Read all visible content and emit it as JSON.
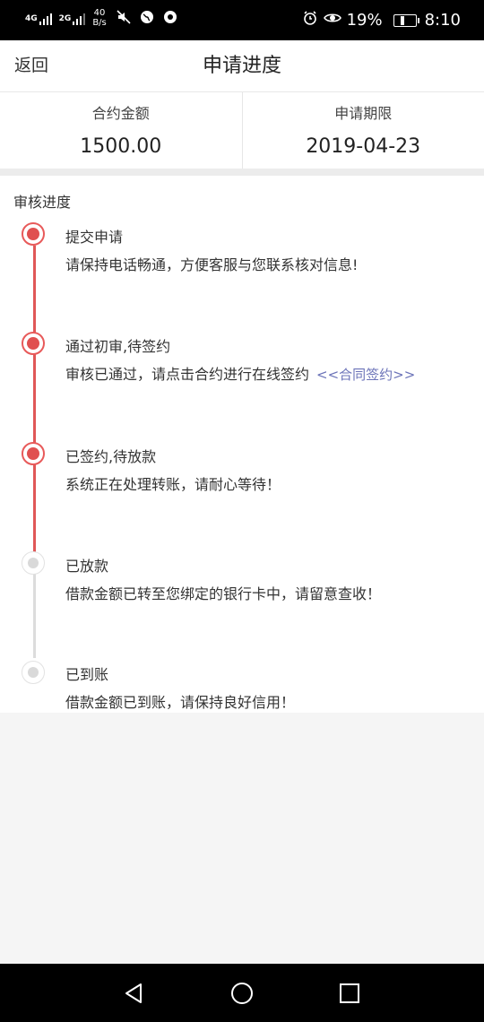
{
  "status_bar": {
    "net1": "4G",
    "net2": "2G",
    "speed_value": "40",
    "speed_unit": "B/s",
    "battery_text": "19%",
    "battery_level": 0.19,
    "time": "8:10"
  },
  "header": {
    "back_label": "返回",
    "title": "申请进度"
  },
  "summary": {
    "amount_label": "合约金额",
    "amount_value": "1500.00",
    "term_label": "申请期限",
    "term_value": "2019-04-23"
  },
  "progress": {
    "section_title": "审核进度",
    "steps": [
      {
        "title": "提交申请",
        "desc": "请保持电话畅通，方便客服与您联系核对信息!",
        "status": "done"
      },
      {
        "title": "通过初审,待签约",
        "desc": "审核已通过，请点击合约进行在线签约",
        "link": "<<合同签约>>",
        "status": "done"
      },
      {
        "title": "已签约,待放款",
        "desc": "系统正在处理转账，请耐心等待！",
        "status": "done"
      },
      {
        "title": "已放款",
        "desc": "借款金额已转至您绑定的银行卡中，请留意查收！",
        "status": "pending"
      },
      {
        "title": "已到账",
        "desc": "借款金额已到账，请保持良好信用！",
        "status": "pending"
      }
    ]
  },
  "colors": {
    "accent_red": "#e05050",
    "link_purple": "#6b73b8",
    "pending_gray": "#d9d9d9"
  }
}
